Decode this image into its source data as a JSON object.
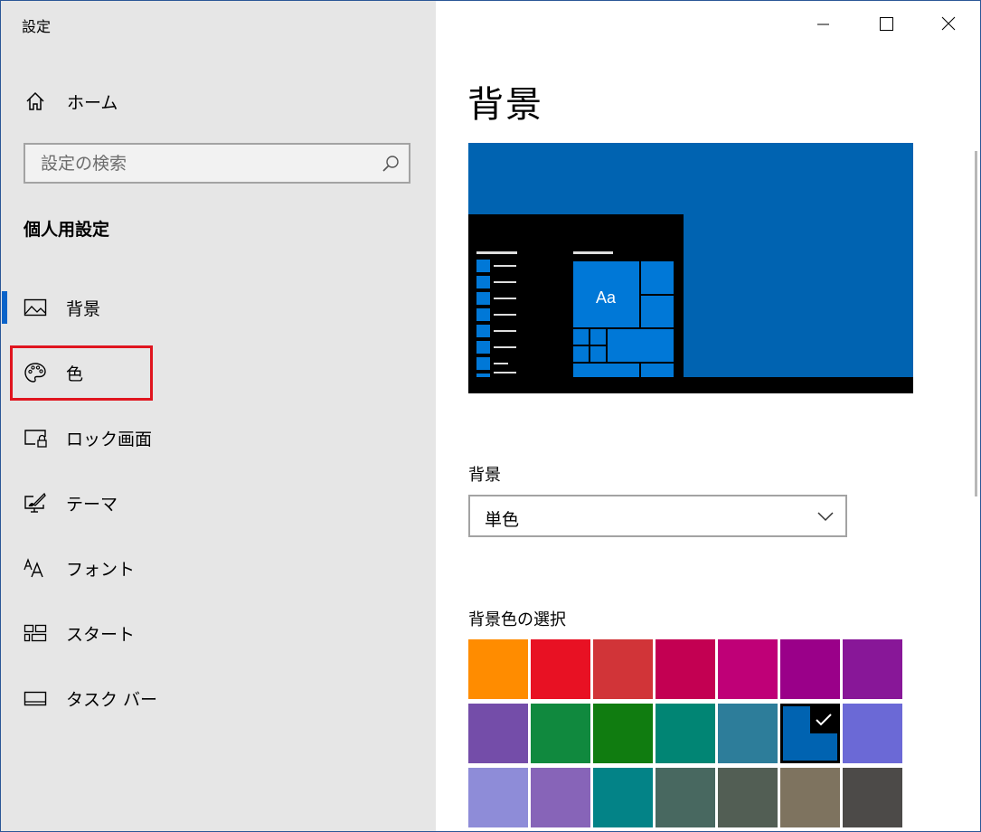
{
  "window": {
    "title": "設定"
  },
  "sidebar": {
    "home_label": "ホーム",
    "search_placeholder": "設定の検索",
    "section_title": "個人用設定",
    "items": [
      {
        "label": "背景",
        "icon": "picture-icon",
        "selected": true
      },
      {
        "label": "色",
        "icon": "palette-icon",
        "selected": false
      },
      {
        "label": "ロック画面",
        "icon": "lock-screen-icon",
        "selected": false
      },
      {
        "label": "テーマ",
        "icon": "theme-brush-icon",
        "selected": false
      },
      {
        "label": "フォント",
        "icon": "font-icon",
        "selected": false
      },
      {
        "label": "スタート",
        "icon": "start-tiles-icon",
        "selected": false
      },
      {
        "label": "タスク バー",
        "icon": "taskbar-icon",
        "selected": false
      }
    ]
  },
  "main": {
    "page_title": "背景",
    "preview": {
      "tile_text": "Aa",
      "background_color": "#0063b1",
      "accent_color": "#0078d7"
    },
    "background_label": "背景",
    "background_value": "単色",
    "color_picker_label": "背景色の選択",
    "colors": [
      "#ff8c00",
      "#e81123",
      "#d13438",
      "#c30052",
      "#bf0077",
      "#9a0089",
      "#881798",
      "#744da9",
      "#10893e",
      "#107c10",
      "#018574",
      "#2d7d9a",
      "#0063b1",
      "#6b69d6",
      "#8e8cd8",
      "#8764b8",
      "#038387",
      "#486860",
      "#525e54",
      "#7e735f",
      "#4c4a48"
    ],
    "selected_color_index": 12
  },
  "colors": {
    "accent": "#0a63c9",
    "highlight": "#e0151f",
    "sidebar_bg": "#e6e6e6"
  }
}
